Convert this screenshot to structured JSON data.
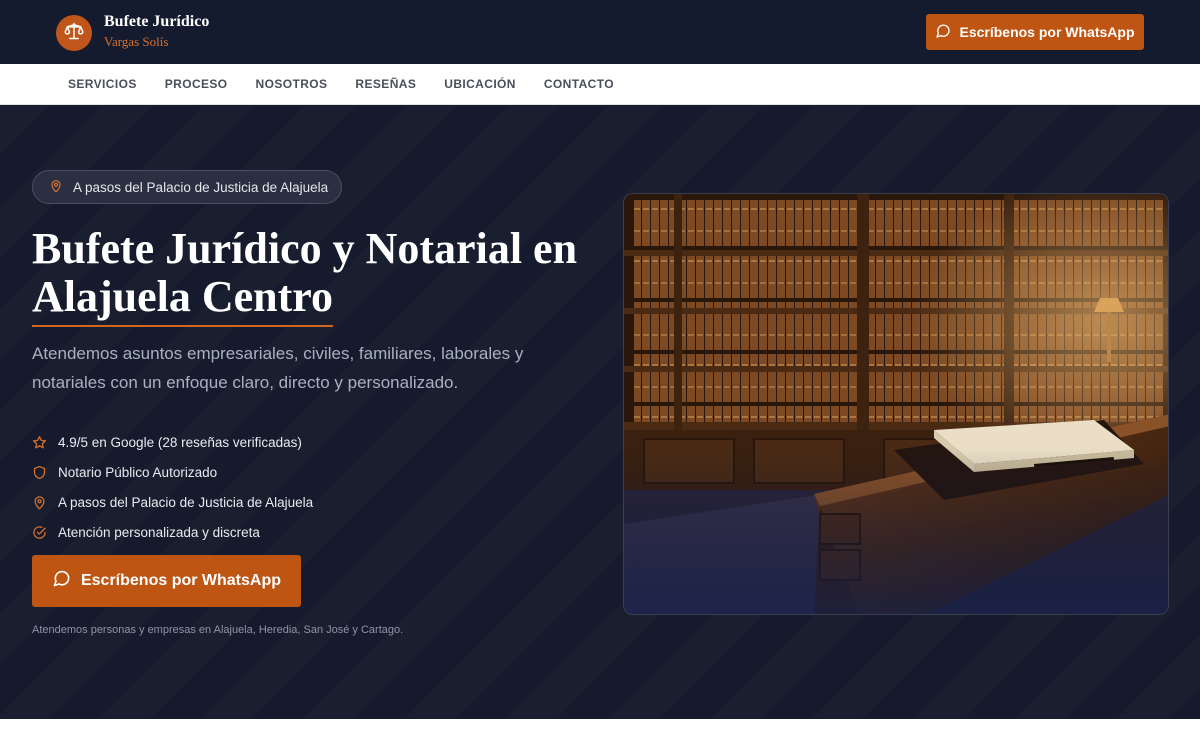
{
  "header": {
    "brand_title": "Bufete Jurídico",
    "brand_subtitle": "Vargas Solís",
    "logo_icon": "scales-of-justice-icon",
    "cta_label": "Escríbenos por WhatsApp",
    "cta_icon": "chat-bubble-icon"
  },
  "nav": {
    "items": [
      "SERVICIOS",
      "PROCESO",
      "NOSOTROS",
      "RESEÑAS",
      "UBICACIÓN",
      "CONTACTO"
    ]
  },
  "hero": {
    "pill_label": "A pasos del Palacio de Justicia de Alajuela",
    "pill_icon": "map-pin-icon",
    "headline_line1": "Bufete Jurídico y Notarial en",
    "headline_line2": "Alajuela Centro",
    "subtext": "Atendemos asuntos empresariales, civiles, familiares, laborales y notariales con un enfoque claro, directo y personalizado.",
    "features": [
      {
        "icon": "star-icon",
        "label": "4.9/5 en Google (28 reseñas verificadas)"
      },
      {
        "icon": "shield-icon",
        "label": "Notario Público Autorizado"
      },
      {
        "icon": "map-pin-icon",
        "label": "A pasos del Palacio de Justicia de Alajuela"
      },
      {
        "icon": "check-circle-icon",
        "label": "Atención personalizada y discreta"
      }
    ],
    "cta_label": "Escríbenos por WhatsApp",
    "footnote": "Atendemos personas y empresas en Alajuela, Heredia, San José y Cartago."
  },
  "colors": {
    "navy": "#141b2e",
    "accent_orange": "#bf5512",
    "nav_text": "#4a4f5a"
  }
}
